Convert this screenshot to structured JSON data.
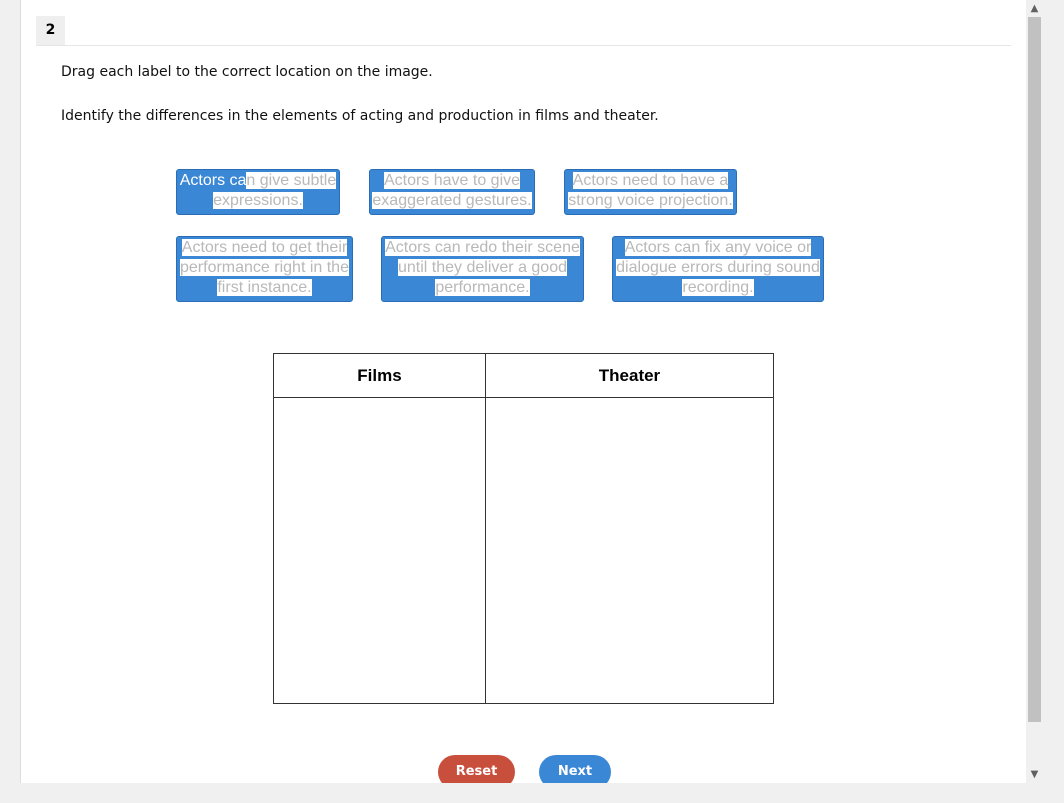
{
  "question": {
    "number": "2",
    "instruction_1": "Drag each label to the correct location on the image.",
    "instruction_2": "Identify the differences in the elements of acting and production in films and theater."
  },
  "labels": [
    {
      "lead": "Actors ca",
      "rest": "n give subtle",
      "line2": "expressions."
    },
    {
      "line1": "Actors have to give",
      "line2": "exaggerated gestures."
    },
    {
      "line1": "Actors need to have a",
      "line2": "strong voice projection."
    },
    {
      "line1": "Actors need to get their",
      "line2": "performance right in the",
      "line3": "first instance."
    },
    {
      "line1": "Actors can redo their scene",
      "line2": "until they deliver a good",
      "line3": "performance."
    },
    {
      "line1": "Actors can fix any voice or",
      "line2": "dialogue errors during sound",
      "line3": "recording."
    }
  ],
  "table": {
    "col1_header": "Films",
    "col2_header": "Theater"
  },
  "buttons": {
    "reset": "Reset",
    "next": "Next"
  },
  "scrollbar": {
    "up_icon": "▲",
    "down_icon": "▼"
  }
}
